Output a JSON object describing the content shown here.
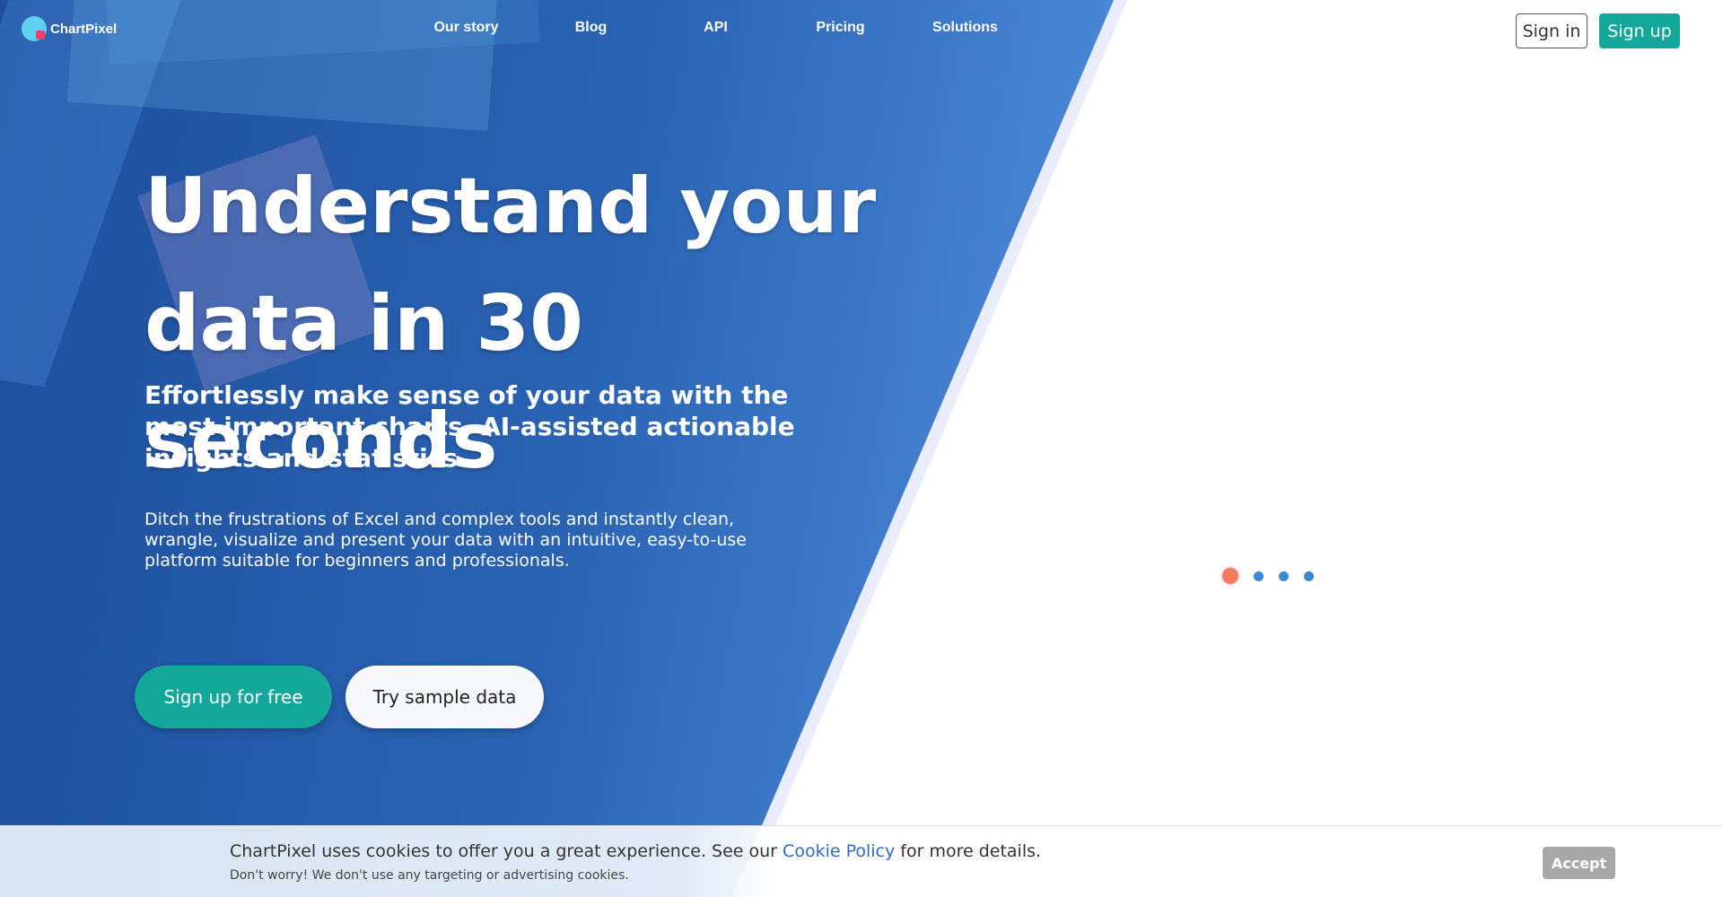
{
  "brand": {
    "name": "ChartPixel",
    "logo_icon": "chartpixel-logo-icon",
    "accent_color": "#13a89a",
    "hero_color": "#2a63b3"
  },
  "nav": {
    "items": [
      {
        "label": "Our story"
      },
      {
        "label": "Blog"
      },
      {
        "label": "API"
      },
      {
        "label": "Pricing"
      },
      {
        "label": "Solutions"
      }
    ],
    "sign_in_label": "Sign in",
    "sign_up_label": "Sign up"
  },
  "hero": {
    "headline_line1": "Understand your",
    "headline_line2": "data in 30 seconds",
    "subheadline": "Effortlessly make sense of your data with the most important charts, AI-assisted actionable insights and statistics.",
    "description": "Ditch the frustrations of Excel and complex tools and instantly clean, wrangle, visualize and present your data with an intuitive, easy-to-use platform suitable for beginners and professionals.",
    "cta_primary": "Sign up for free",
    "cta_secondary": "Try sample data"
  },
  "loader": {
    "dot_count": 4,
    "active_index": 0,
    "active_color": "#f57a62",
    "dot_color": "#3a8ad8"
  },
  "cookie": {
    "text_before": "ChartPixel uses cookies to offer you a great experience. See our",
    "link_label": "Cookie Policy",
    "text_after": "for more details.",
    "subtext": "Don't worry! We don't use any targeting or advertising cookies.",
    "accept_label": "Accept"
  }
}
